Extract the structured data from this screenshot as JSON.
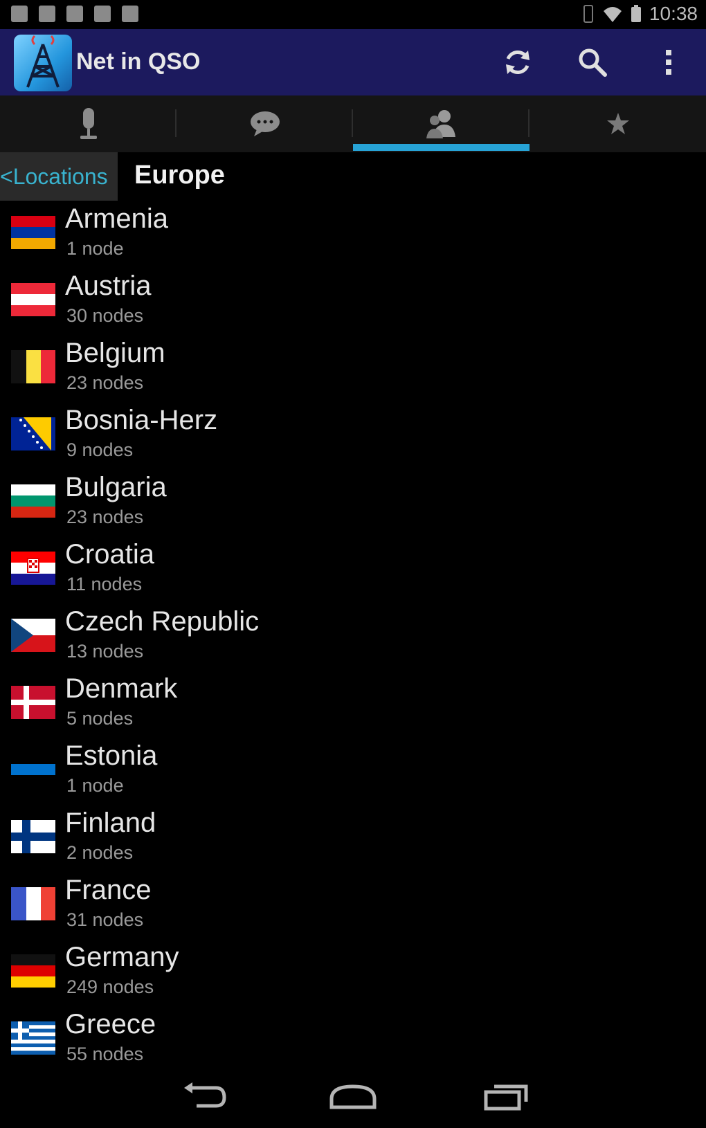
{
  "status_bar": {
    "time": "10:38"
  },
  "action_bar": {
    "title": "Net in QSO"
  },
  "tabs": [
    {
      "name": "tab-microphone",
      "icon": "microphone-icon",
      "active": false
    },
    {
      "name": "tab-chat",
      "icon": "chat-bubble-icon",
      "active": false
    },
    {
      "name": "tab-people",
      "icon": "people-icon",
      "active": true
    },
    {
      "name": "tab-favorites",
      "icon": "star-icon",
      "active": false
    }
  ],
  "breadcrumb": {
    "back_label": "<Locations",
    "current": "Europe"
  },
  "countries": [
    {
      "name": "Armenia",
      "count": "1 node"
    },
    {
      "name": "Austria",
      "count": "30 nodes"
    },
    {
      "name": "Belgium",
      "count": "23 nodes"
    },
    {
      "name": "Bosnia-Herz",
      "count": "9 nodes"
    },
    {
      "name": "Bulgaria",
      "count": "23 nodes"
    },
    {
      "name": "Croatia",
      "count": "11 nodes"
    },
    {
      "name": "Czech Republic",
      "count": "13 nodes"
    },
    {
      "name": "Denmark",
      "count": "5 nodes"
    },
    {
      "name": "Estonia",
      "count": "1 node"
    },
    {
      "name": "Finland",
      "count": "2 nodes"
    },
    {
      "name": "France",
      "count": "31 nodes"
    },
    {
      "name": "Germany",
      "count": "249 nodes"
    },
    {
      "name": "Greece",
      "count": "55 nodes"
    }
  ],
  "colors": {
    "action_bar": "#1c1a5e",
    "tab_indicator": "#27a3d6",
    "breadcrumb_link": "#39b3cf"
  }
}
